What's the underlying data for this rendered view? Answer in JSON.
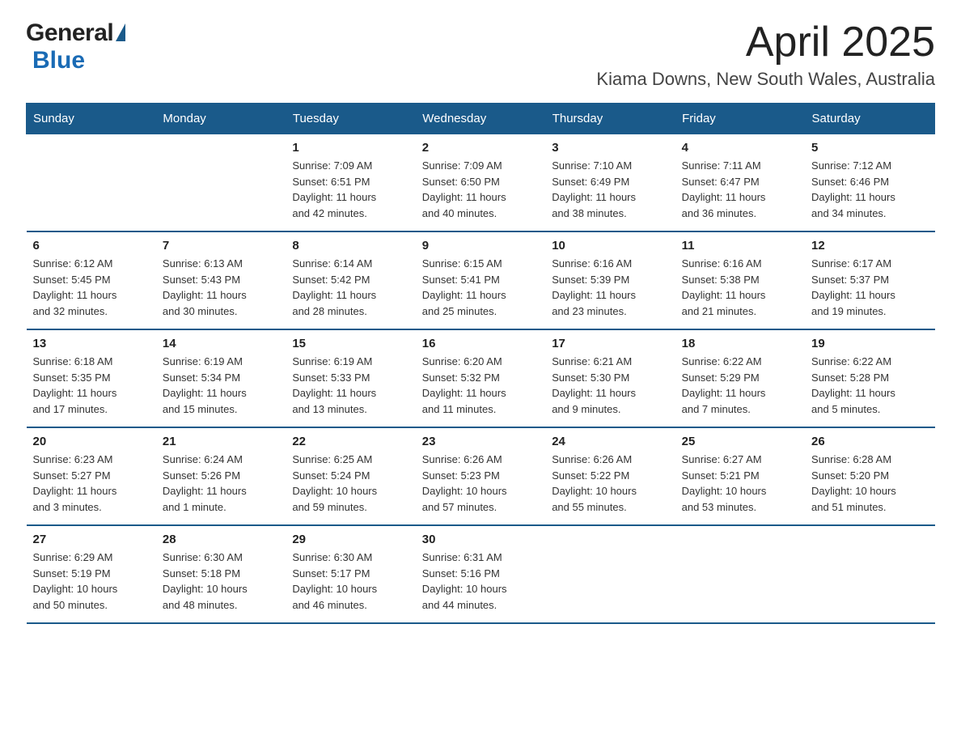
{
  "header": {
    "logo_general": "General",
    "logo_blue": "Blue",
    "month": "April 2025",
    "location": "Kiama Downs, New South Wales, Australia"
  },
  "weekdays": [
    "Sunday",
    "Monday",
    "Tuesday",
    "Wednesday",
    "Thursday",
    "Friday",
    "Saturday"
  ],
  "weeks": [
    [
      {
        "day": "",
        "info": ""
      },
      {
        "day": "",
        "info": ""
      },
      {
        "day": "1",
        "info": "Sunrise: 7:09 AM\nSunset: 6:51 PM\nDaylight: 11 hours\nand 42 minutes."
      },
      {
        "day": "2",
        "info": "Sunrise: 7:09 AM\nSunset: 6:50 PM\nDaylight: 11 hours\nand 40 minutes."
      },
      {
        "day": "3",
        "info": "Sunrise: 7:10 AM\nSunset: 6:49 PM\nDaylight: 11 hours\nand 38 minutes."
      },
      {
        "day": "4",
        "info": "Sunrise: 7:11 AM\nSunset: 6:47 PM\nDaylight: 11 hours\nand 36 minutes."
      },
      {
        "day": "5",
        "info": "Sunrise: 7:12 AM\nSunset: 6:46 PM\nDaylight: 11 hours\nand 34 minutes."
      }
    ],
    [
      {
        "day": "6",
        "info": "Sunrise: 6:12 AM\nSunset: 5:45 PM\nDaylight: 11 hours\nand 32 minutes."
      },
      {
        "day": "7",
        "info": "Sunrise: 6:13 AM\nSunset: 5:43 PM\nDaylight: 11 hours\nand 30 minutes."
      },
      {
        "day": "8",
        "info": "Sunrise: 6:14 AM\nSunset: 5:42 PM\nDaylight: 11 hours\nand 28 minutes."
      },
      {
        "day": "9",
        "info": "Sunrise: 6:15 AM\nSunset: 5:41 PM\nDaylight: 11 hours\nand 25 minutes."
      },
      {
        "day": "10",
        "info": "Sunrise: 6:16 AM\nSunset: 5:39 PM\nDaylight: 11 hours\nand 23 minutes."
      },
      {
        "day": "11",
        "info": "Sunrise: 6:16 AM\nSunset: 5:38 PM\nDaylight: 11 hours\nand 21 minutes."
      },
      {
        "day": "12",
        "info": "Sunrise: 6:17 AM\nSunset: 5:37 PM\nDaylight: 11 hours\nand 19 minutes."
      }
    ],
    [
      {
        "day": "13",
        "info": "Sunrise: 6:18 AM\nSunset: 5:35 PM\nDaylight: 11 hours\nand 17 minutes."
      },
      {
        "day": "14",
        "info": "Sunrise: 6:19 AM\nSunset: 5:34 PM\nDaylight: 11 hours\nand 15 minutes."
      },
      {
        "day": "15",
        "info": "Sunrise: 6:19 AM\nSunset: 5:33 PM\nDaylight: 11 hours\nand 13 minutes."
      },
      {
        "day": "16",
        "info": "Sunrise: 6:20 AM\nSunset: 5:32 PM\nDaylight: 11 hours\nand 11 minutes."
      },
      {
        "day": "17",
        "info": "Sunrise: 6:21 AM\nSunset: 5:30 PM\nDaylight: 11 hours\nand 9 minutes."
      },
      {
        "day": "18",
        "info": "Sunrise: 6:22 AM\nSunset: 5:29 PM\nDaylight: 11 hours\nand 7 minutes."
      },
      {
        "day": "19",
        "info": "Sunrise: 6:22 AM\nSunset: 5:28 PM\nDaylight: 11 hours\nand 5 minutes."
      }
    ],
    [
      {
        "day": "20",
        "info": "Sunrise: 6:23 AM\nSunset: 5:27 PM\nDaylight: 11 hours\nand 3 minutes."
      },
      {
        "day": "21",
        "info": "Sunrise: 6:24 AM\nSunset: 5:26 PM\nDaylight: 11 hours\nand 1 minute."
      },
      {
        "day": "22",
        "info": "Sunrise: 6:25 AM\nSunset: 5:24 PM\nDaylight: 10 hours\nand 59 minutes."
      },
      {
        "day": "23",
        "info": "Sunrise: 6:26 AM\nSunset: 5:23 PM\nDaylight: 10 hours\nand 57 minutes."
      },
      {
        "day": "24",
        "info": "Sunrise: 6:26 AM\nSunset: 5:22 PM\nDaylight: 10 hours\nand 55 minutes."
      },
      {
        "day": "25",
        "info": "Sunrise: 6:27 AM\nSunset: 5:21 PM\nDaylight: 10 hours\nand 53 minutes."
      },
      {
        "day": "26",
        "info": "Sunrise: 6:28 AM\nSunset: 5:20 PM\nDaylight: 10 hours\nand 51 minutes."
      }
    ],
    [
      {
        "day": "27",
        "info": "Sunrise: 6:29 AM\nSunset: 5:19 PM\nDaylight: 10 hours\nand 50 minutes."
      },
      {
        "day": "28",
        "info": "Sunrise: 6:30 AM\nSunset: 5:18 PM\nDaylight: 10 hours\nand 48 minutes."
      },
      {
        "day": "29",
        "info": "Sunrise: 6:30 AM\nSunset: 5:17 PM\nDaylight: 10 hours\nand 46 minutes."
      },
      {
        "day": "30",
        "info": "Sunrise: 6:31 AM\nSunset: 5:16 PM\nDaylight: 10 hours\nand 44 minutes."
      },
      {
        "day": "",
        "info": ""
      },
      {
        "day": "",
        "info": ""
      },
      {
        "day": "",
        "info": ""
      }
    ]
  ]
}
